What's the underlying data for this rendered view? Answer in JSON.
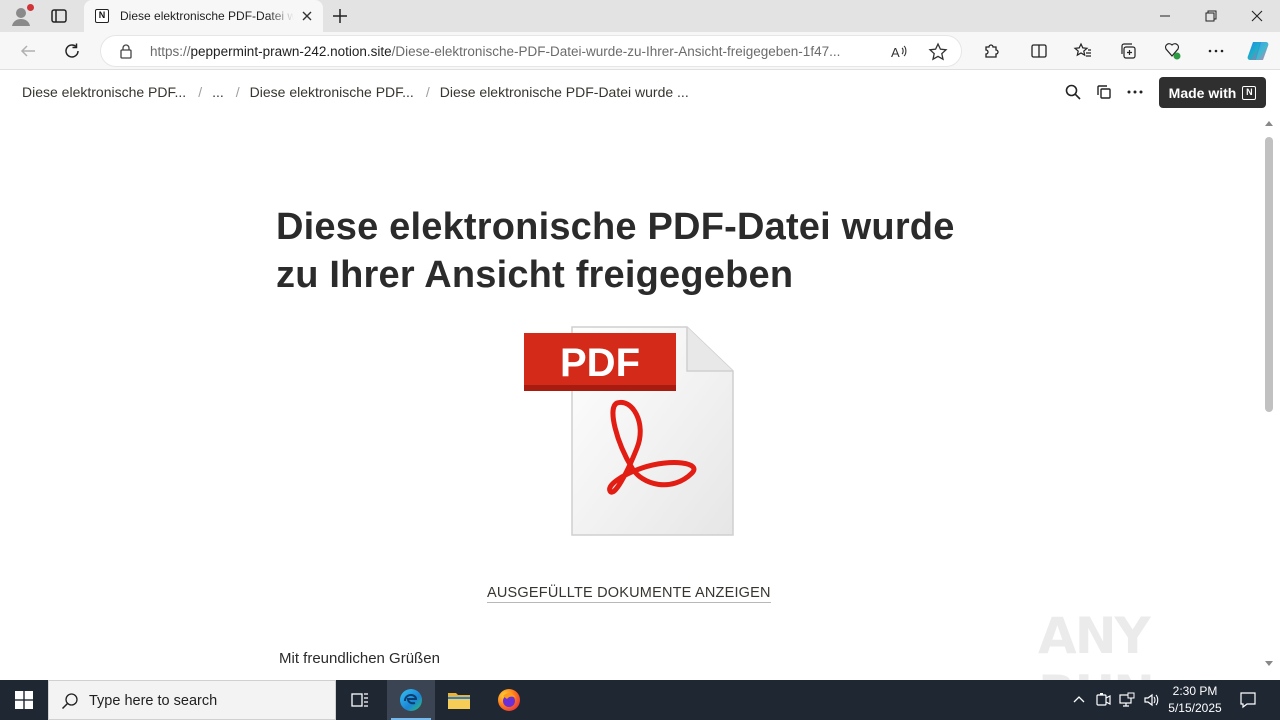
{
  "browser": {
    "tab_title": "Diese elektronische PDF-Datei wurde zu Ihrer Ansicht freigegeben",
    "tab_favicon": "N",
    "url_host": "peppermint-prawn-242.notion.site",
    "url_scheme": "https://",
    "url_path": "/Diese-elektronische-PDF-Datei-wurde-zu-Ihrer-Ansicht-freigegeben-1f47..."
  },
  "notion": {
    "breadcrumbs": [
      "Diese elektronische PDF...",
      "...",
      "Diese elektronische PDF...",
      "Diese elektronische PDF-Datei wurde ..."
    ],
    "made_with_label": "Made with",
    "made_with_logo": "N"
  },
  "page": {
    "title": "Diese elektronische PDF-Datei wurde zu Ihrer Ansicht freigegeben",
    "pdf_badge": "PDF",
    "cta_link": "AUSGEFÜLLTE DOKUMENTE ANZEIGEN",
    "greeting": "Mit freundlichen Grüßen"
  },
  "watermark": "ANY RUN",
  "taskbar": {
    "search_placeholder": "Type here to search",
    "time": "2:30 PM",
    "date": "5/15/2025"
  },
  "colors": {
    "pdf_red": "#d42a1a",
    "taskbar": "#1f2733",
    "made_with_bg": "#2f2f2f"
  }
}
